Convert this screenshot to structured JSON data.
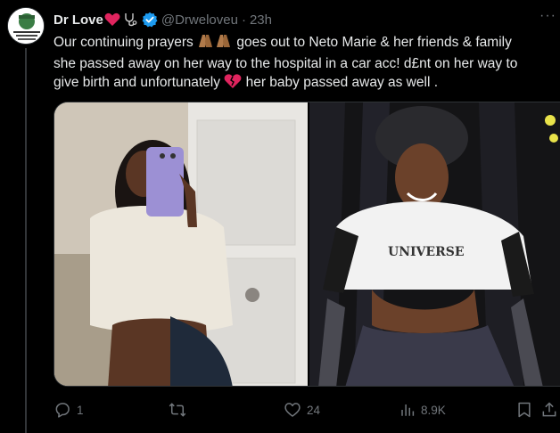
{
  "post": {
    "author_name": "Dr Love",
    "handle": "@Drweloveu",
    "separator": "·",
    "time": "23h",
    "more_label": "···",
    "text_line1_a": "Our continuing prayers ",
    "text_line1_b": " goes out to Neto Marie & her friends & family",
    "text_line2": "she passed away on her way to the hospital in a car acc! d£nt on her way to",
    "text_line3_a": "give birth and unfortunately ",
    "text_line3_b": " her baby passed away as well ."
  },
  "metrics": {
    "replies": "1",
    "likes": "24",
    "views": "8.9K"
  },
  "colors": {
    "background": "#000000",
    "text": "#e7e9ea",
    "muted": "#71767b",
    "verified": "#1d9bf0",
    "heart": "#e0245e"
  },
  "icons": {
    "heart_emoji": "red-heart-emoji",
    "stethoscope": "stethoscope-icon",
    "verified": "verified-badge-icon",
    "prayer": "folded-hands-emoji",
    "broken_heart": "broken-heart-emoji",
    "reply": "reply-icon",
    "retweet": "retweet-icon",
    "like": "like-icon",
    "views": "views-icon",
    "bookmark": "bookmark-icon",
    "share": "share-icon"
  }
}
